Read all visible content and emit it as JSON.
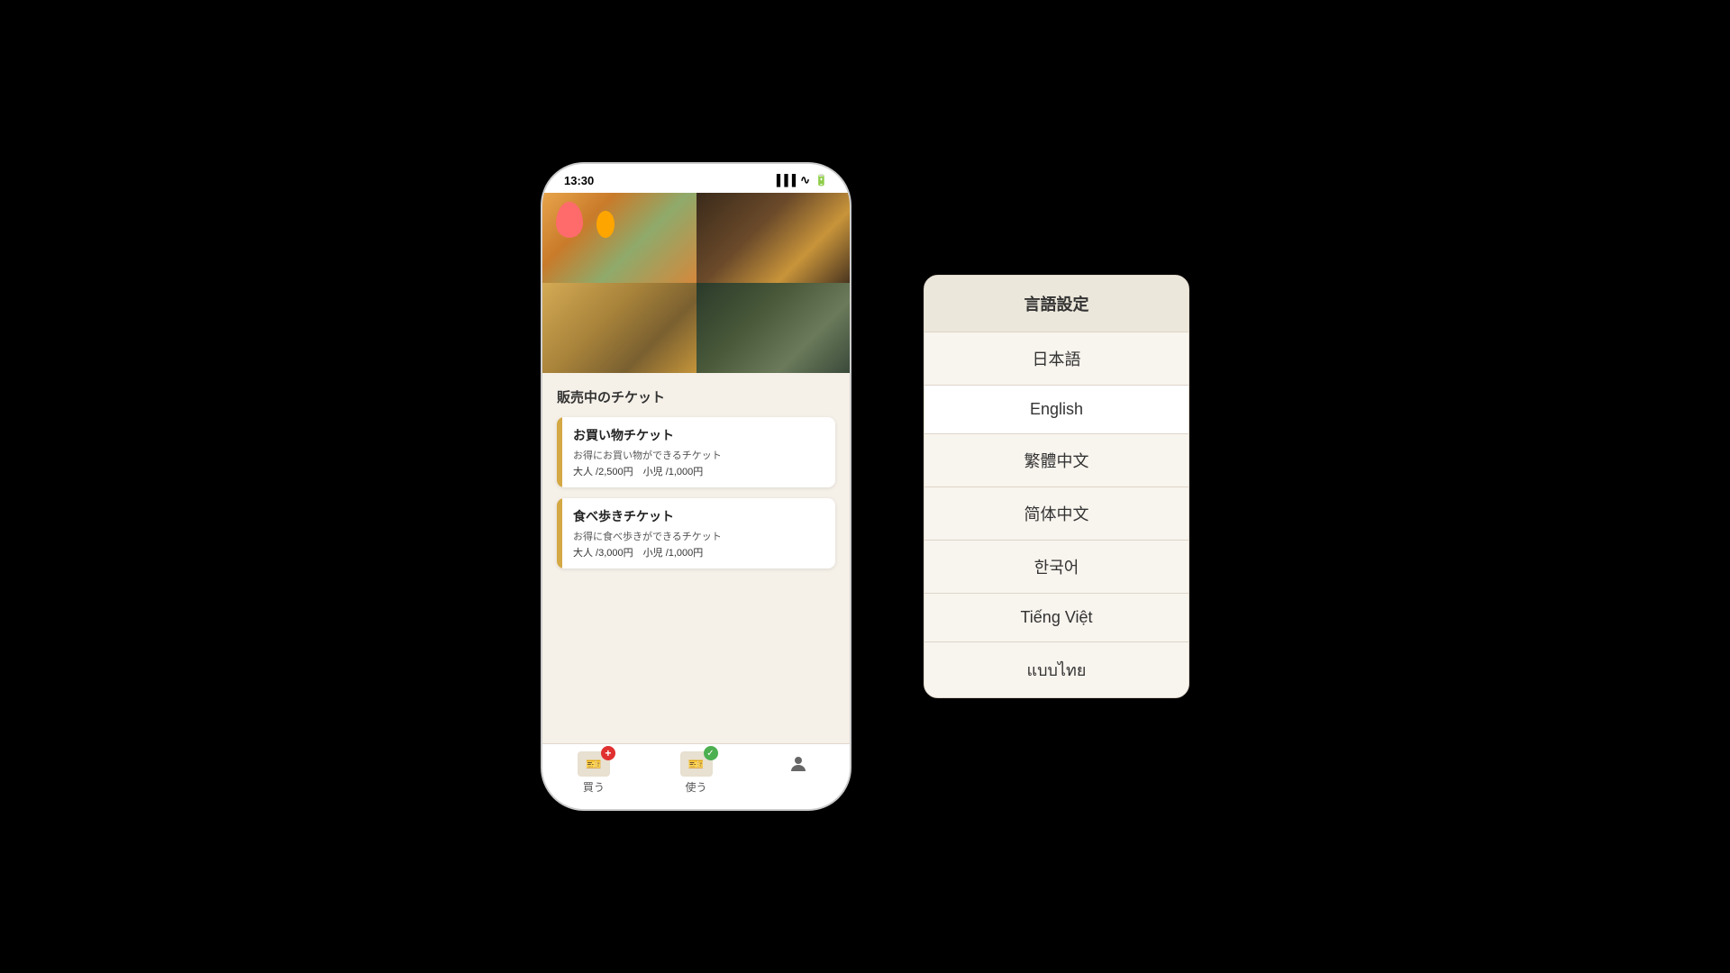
{
  "statusBar": {
    "time": "13:30",
    "signal": "▐▐▐▌",
    "wifi": "wifi",
    "battery": "battery"
  },
  "phone": {
    "sectionTitle": "販売中のチケット",
    "tickets": [
      {
        "title": "お買い物チケット",
        "desc": "お得にお買い物ができるチケット",
        "price": "大人 /2,500円　小児 /1,000円"
      },
      {
        "title": "食べ歩きチケット",
        "desc": "お得に食べ歩きができるチケット",
        "price": "大人 /3,000円　小児 /1,000円"
      }
    ],
    "nav": {
      "buy": "買う",
      "use": "使う"
    }
  },
  "languageModal": {
    "title": "言語設定",
    "languages": [
      {
        "label": "日本語",
        "active": false
      },
      {
        "label": "English",
        "active": true
      },
      {
        "label": "繁體中文",
        "active": false
      },
      {
        "label": "简体中文",
        "active": false
      },
      {
        "label": "한국어",
        "active": false
      },
      {
        "label": "Tiếng Việt",
        "active": false
      },
      {
        "label": "แบบไทย",
        "active": false
      }
    ]
  }
}
